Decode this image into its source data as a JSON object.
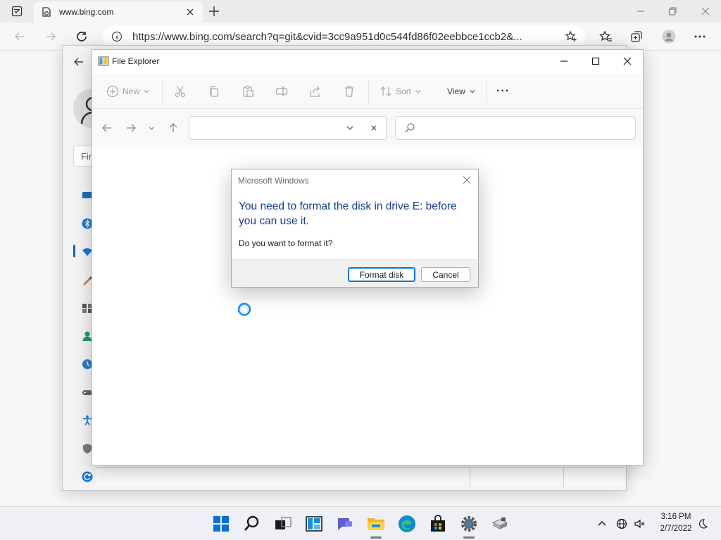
{
  "browser": {
    "tab_title": "www.bing.com",
    "url": "https://www.bing.com/search?q=git&cvid=3cc9a951d0c544fd86f02eebbce1ccb2&..."
  },
  "settings": {
    "search_placeholder": "Fin"
  },
  "file_explorer": {
    "title": "File Explorer",
    "commands": {
      "new": "New",
      "sort": "Sort",
      "view": "View",
      "more": "···"
    }
  },
  "dialog": {
    "title": "Microsoft Windows",
    "heading": "You need to format the disk in drive E: before you can use it.",
    "body": "Do you want to format it?",
    "primary_button": "Format disk",
    "secondary_button": "Cancel"
  },
  "taskbar": {
    "time": "3:16 PM",
    "date": "2/7/2022",
    "apps": [
      "start-icon",
      "search-icon",
      "task-view-icon",
      "widgets-icon",
      "chat-icon",
      "file-explorer-icon",
      "edge-icon",
      "store-icon",
      "settings-icon",
      "usb-drive-icon"
    ]
  },
  "colors": {
    "accent": "#0078d4",
    "dialog_heading": "#1a3e8a",
    "taskbar_bg": "#eef0f5"
  }
}
